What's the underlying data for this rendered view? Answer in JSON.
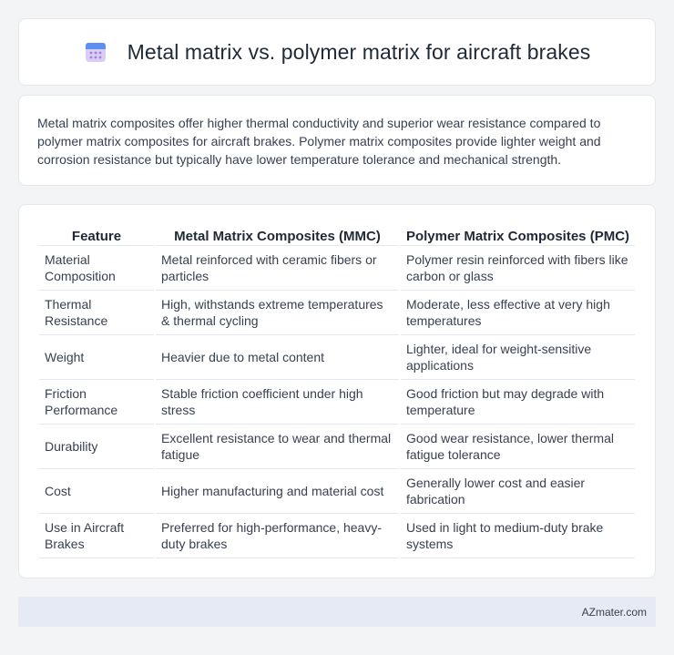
{
  "header": {
    "icon": "calendar-icon",
    "title": "Metal matrix vs. polymer matrix for aircraft brakes"
  },
  "summary": {
    "text": "Metal matrix composites offer higher thermal conductivity and superior wear resistance compared to polymer matrix composites for aircraft brakes. Polymer matrix composites provide lighter weight and corrosion resistance but typically have lower temperature tolerance and mechanical strength."
  },
  "table": {
    "headers": [
      "Feature",
      "Metal Matrix Composites (MMC)",
      "Polymer Matrix Composites (PMC)"
    ],
    "rows": [
      [
        "Material Composition",
        "Metal reinforced with ceramic fibers or particles",
        "Polymer resin reinforced with fibers like carbon or glass"
      ],
      [
        "Thermal Resistance",
        "High, withstands extreme temperatures & thermal cycling",
        "Moderate, less effective at very high temperatures"
      ],
      [
        "Weight",
        "Heavier due to metal content",
        "Lighter, ideal for weight-sensitive applications"
      ],
      [
        "Friction Performance",
        "Stable friction coefficient under high stress",
        "Good friction but may degrade with temperature"
      ],
      [
        "Durability",
        "Excellent resistance to wear and thermal fatigue",
        "Good wear resistance, lower thermal fatigue tolerance"
      ],
      [
        "Cost",
        "Higher manufacturing and material cost",
        "Generally lower cost and easier fabrication"
      ],
      [
        "Use in Aircraft Brakes",
        "Preferred for high-performance, heavy-duty brakes",
        "Used in light to medium-duty brake systems"
      ]
    ]
  },
  "footer": {
    "text": "AZmater.com"
  },
  "colors": {
    "background": "#f3f4f6",
    "card": "#ffffff",
    "footer_bg": "#e5eaf5",
    "icon_top": "#4f8ef7",
    "icon_body": "#c7b8f0"
  }
}
